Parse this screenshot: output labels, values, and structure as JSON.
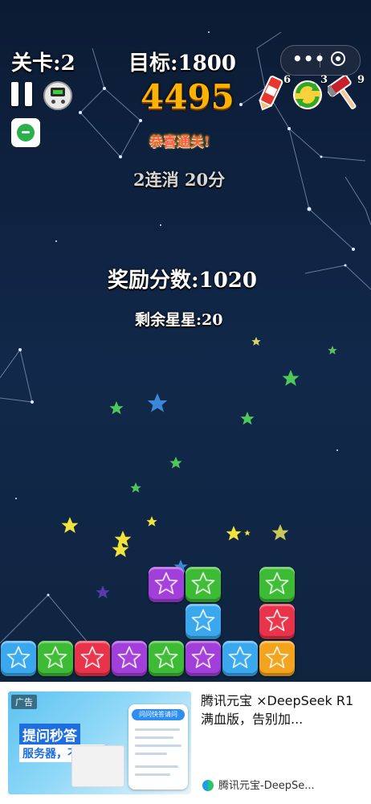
{
  "hud": {
    "level_label": "关卡:2",
    "target_label": "目标:1800",
    "score": "4495",
    "congrats": "恭喜通关!",
    "combo_text": "2连消 20分",
    "reward_text": "奖励分数:1020",
    "remaining_text": "剩余星星:20"
  },
  "capsule": {
    "more_icon": "more-dots-icon",
    "close_icon": "target-circle-icon",
    "more_glyph": "•••"
  },
  "tools": [
    {
      "name": "pop-marker-tool",
      "count": "6",
      "color": "#e8352e"
    },
    {
      "name": "refresh-tool",
      "count": "3",
      "color": "#3cc13b"
    },
    {
      "name": "hammer-tool",
      "count": "9",
      "color": "#c8202a"
    }
  ],
  "colors": {
    "blue": "#3aa8ee",
    "green": "#3dbb34",
    "red": "#e8334a",
    "purple": "#a23ed9",
    "orange": "#f4a31c",
    "score": "#ffb300"
  },
  "board": {
    "bottom_row": [
      "blue",
      "green",
      "red",
      "purple",
      "green",
      "purple",
      "blue",
      "orange"
    ],
    "upper_blocks": [
      {
        "col": 5,
        "row": 1,
        "color": "blue"
      },
      {
        "col": 7,
        "row": 1,
        "color": "red"
      },
      {
        "col": 4,
        "row": 2,
        "color": "purple"
      },
      {
        "col": 5,
        "row": 2,
        "color": "green"
      },
      {
        "col": 7,
        "row": 2,
        "color": "green"
      }
    ]
  },
  "ad": {
    "badge": "广告",
    "image_headline": "提问秒答",
    "image_sub": "服务器，不繁忙",
    "image_card_title": "问问快答请问",
    "title": "腾讯元宝 ×DeepSeek R1满血版，告别加...",
    "source": "腾讯元宝-DeepSe..."
  }
}
